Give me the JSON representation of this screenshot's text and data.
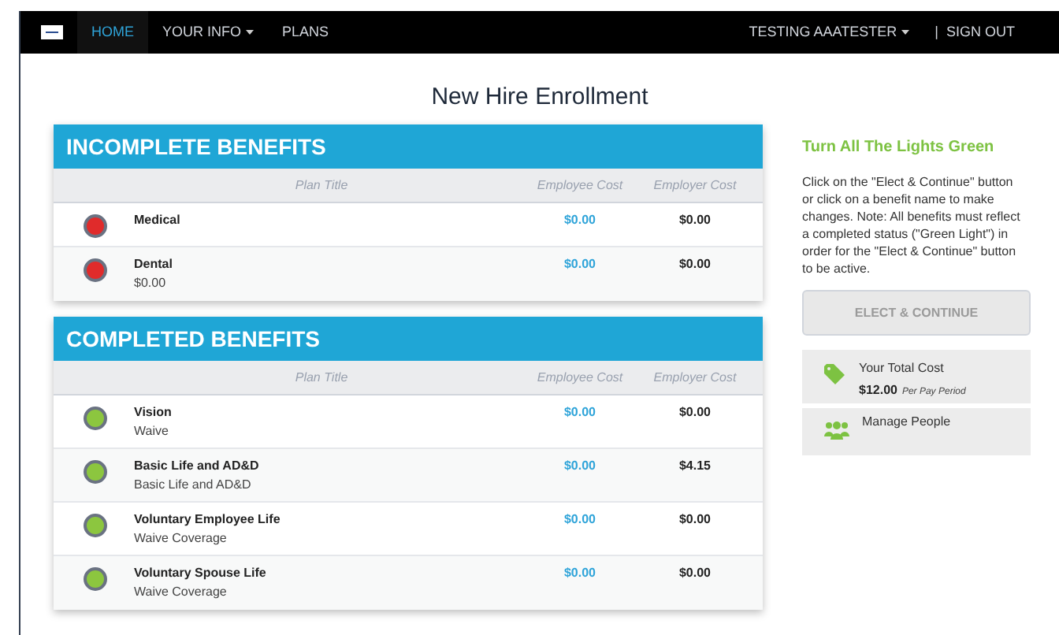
{
  "nav": {
    "items": [
      {
        "label": "HOME",
        "selected": true,
        "dropdown": false
      },
      {
        "label": "YOUR INFO",
        "selected": false,
        "dropdown": true
      },
      {
        "label": "PLANS",
        "selected": false,
        "dropdown": false
      }
    ],
    "user": {
      "label": "TESTING AAATESTER",
      "dropdown": true
    },
    "sign_out": {
      "separator": "|",
      "label": "SIGN OUT"
    }
  },
  "page_title": "New Hire Enrollment",
  "sections": [
    {
      "title": "INCOMPLETE BENEFITS",
      "columns": [
        "Plan Title",
        "Employee Cost",
        "Employer Cost"
      ],
      "rows": [
        {
          "complete": false,
          "name": "Medical",
          "detail": null,
          "employee_cost": "$0.00",
          "employer_cost": "$0.00"
        },
        {
          "complete": false,
          "name": "Dental",
          "detail": "$0.00",
          "employee_cost": "$0.00",
          "employer_cost": "$0.00"
        }
      ]
    },
    {
      "title": "COMPLETED BENEFITS",
      "columns": [
        "Plan Title",
        "Employee Cost",
        "Employer Cost"
      ],
      "rows": [
        {
          "complete": true,
          "name": "Vision",
          "detail": "Waive",
          "employee_cost": "$0.00",
          "employer_cost": "$0.00"
        },
        {
          "complete": true,
          "name": "Basic Life and AD&D",
          "detail": "Basic Life and AD&D",
          "employee_cost": "$0.00",
          "employer_cost": "$4.15"
        },
        {
          "complete": true,
          "name": "Voluntary Employee Life",
          "detail": "Waive Coverage",
          "employee_cost": "$0.00",
          "employer_cost": "$0.00"
        },
        {
          "complete": true,
          "name": "Voluntary Spouse Life",
          "detail": "Waive Coverage",
          "employee_cost": "$0.00",
          "employer_cost": "$0.00"
        }
      ]
    }
  ],
  "sidebar": {
    "heading": "Turn All The Lights Green",
    "text": "Click on the \"Elect & Continue\" button or click on a benefit name to make changes. Note: All benefits must reflect a completed status (\"Green Light\") in order for the \"Elect & Continue\" button to be active.",
    "button": {
      "label": "ELECT & CONTINUE",
      "disabled": true
    },
    "total_cost": {
      "label": "Your Total Cost",
      "amount": "$12.00",
      "period": "Per Pay Period"
    },
    "manage_people": {
      "label": "Manage People"
    }
  }
}
